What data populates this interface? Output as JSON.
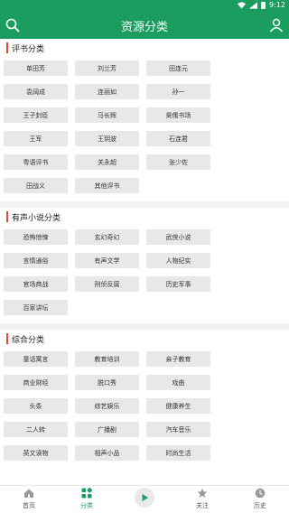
{
  "status": {
    "time": "9:12"
  },
  "header": {
    "title": "资源分类"
  },
  "sections": [
    {
      "title": "评书分类",
      "items": [
        "单田芳",
        "刘兰芳",
        "田连元",
        "袁阔成",
        "连丽如",
        "孙一",
        "王子封臣",
        "马长辉",
        "昊儒书场",
        "王军",
        "王玥波",
        "石连君",
        "粤语评书",
        "关永超",
        "张少佐",
        "田战义",
        "其他评书"
      ]
    },
    {
      "title": "有声小说分类",
      "items": [
        "恐怖惊悚",
        "玄幻奇幻",
        "武侠小说",
        "言情通俗",
        "有声文学",
        "人物纪实",
        "官场商战",
        "刑侦反腐",
        "历史军事",
        "百家讲坛"
      ]
    },
    {
      "title": "综合分类",
      "items": [
        "童话寓言",
        "教育培训",
        "亲子教育",
        "商业财经",
        "脱口秀",
        "戏曲",
        "头条",
        "综艺娱乐",
        "健康养生",
        "二人转",
        "广播剧",
        "汽车音乐",
        "英文读物",
        "相声小品",
        "时尚生活"
      ]
    }
  ],
  "tabs": [
    {
      "label": "首页",
      "icon": "home-icon",
      "active": false
    },
    {
      "label": "分类",
      "icon": "grid-icon",
      "active": true
    },
    {
      "label": "",
      "icon": "play-icon",
      "active": false
    },
    {
      "label": "关注",
      "icon": "star-icon",
      "active": false
    },
    {
      "label": "历史",
      "icon": "clock-icon",
      "active": false
    }
  ],
  "colors": {
    "primary": "#1a9d5e",
    "accent_bar": "#e0492e",
    "chip_bg": "#e8e8e8"
  }
}
